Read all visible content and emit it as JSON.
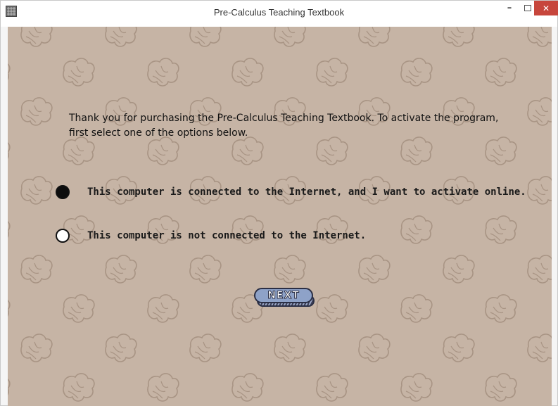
{
  "window": {
    "title": "Pre-Calculus Teaching Textbook",
    "minimize_glyph": "–",
    "close_glyph": "✕"
  },
  "content": {
    "intro_text": "Thank you for purchasing the Pre-Calculus Teaching Textbook. To activate the program, first select one of the options below.",
    "options": [
      {
        "label": "This computer is connected to the Internet, and I want to activate online.",
        "selected": true
      },
      {
        "label": "This computer is not connected to the Internet.",
        "selected": false
      }
    ],
    "next_label": "NEXT"
  },
  "colors": {
    "background": "#c6b4a5",
    "pattern": "#a89484",
    "button": "#8ea2c8",
    "close": "#c7463c"
  },
  "icons": {
    "app": "app-icon",
    "pattern": "hand-pattern-icon",
    "minimize": "minimize-icon",
    "maximize": "maximize-icon",
    "close": "close-icon"
  }
}
